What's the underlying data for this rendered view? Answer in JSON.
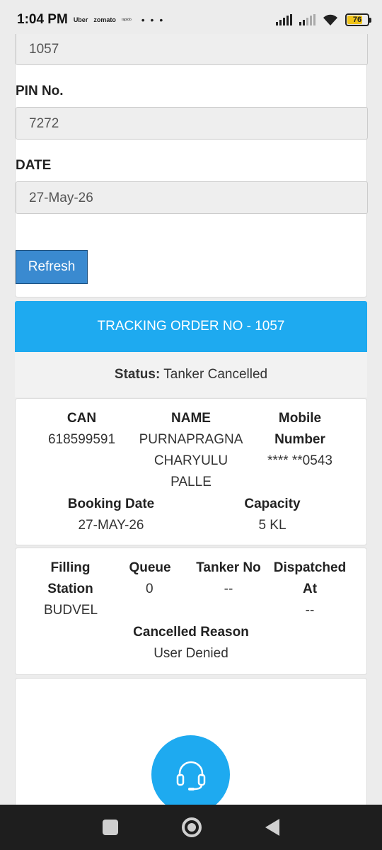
{
  "status_bar": {
    "time": "1:04 PM",
    "app_notifications": [
      "Uber",
      "zomato",
      "rapido"
    ],
    "more_dots": "• • •",
    "battery_level": "76"
  },
  "form": {
    "order_value": "1057",
    "pin_label": "PIN No.",
    "pin_value": "7272",
    "date_label": "DATE",
    "date_value": "27-May-26",
    "refresh_label": "Refresh"
  },
  "tracking": {
    "header": "TRACKING ORDER NO - 1057",
    "status_label": "Status:",
    "status_value": "Tanker Cancelled"
  },
  "details": {
    "can_label": "CAN",
    "can_value": "618599591",
    "name_label": "NAME",
    "name_lines": [
      "PURNAPRAGNA",
      "CHARYULU",
      "PALLE"
    ],
    "mobile_label_lines": [
      "Mobile",
      "Number"
    ],
    "mobile_value": "**** **0543",
    "booking_date_label": "Booking Date",
    "booking_date_value": "27-MAY-26",
    "capacity_label": "Capacity",
    "capacity_value": "5 KL"
  },
  "dispatch": {
    "filling_station_label_lines": [
      "Filling",
      "Station"
    ],
    "filling_station_value": "BUDVEL",
    "queue_label": "Queue",
    "queue_value": "0",
    "tanker_no_label": "Tanker No",
    "tanker_no_value": "--",
    "dispatched_label_lines": [
      "Dispatched",
      "At"
    ],
    "dispatched_value": "--",
    "cancelled_reason_label": "Cancelled Reason",
    "cancelled_reason_value": "User Denied"
  },
  "colors": {
    "accent": "#1eaaf0",
    "button": "#3a8ad0"
  },
  "icons": {
    "support": "headset-icon",
    "nav_recent": "square-icon",
    "nav_home": "circle-icon",
    "nav_back": "triangle-back-icon"
  }
}
